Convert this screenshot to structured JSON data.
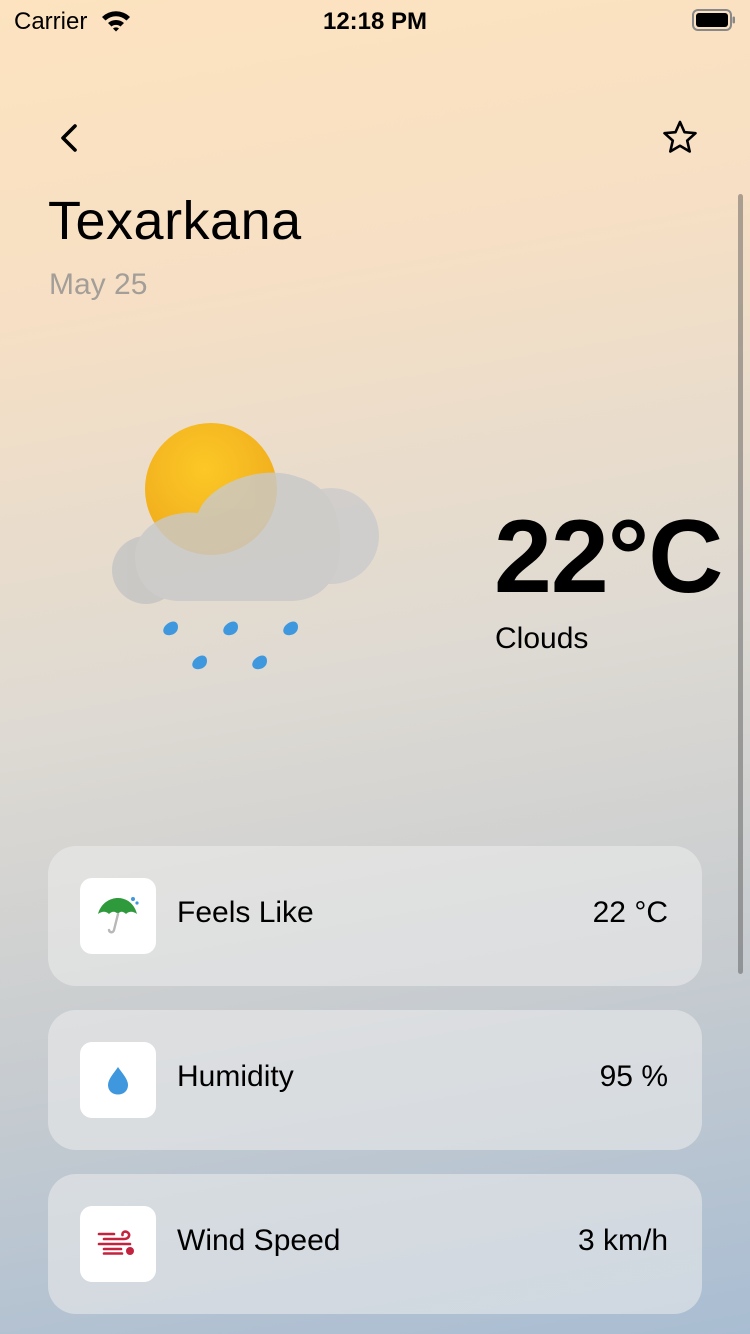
{
  "status_bar": {
    "carrier": "Carrier",
    "time": "12:18 PM"
  },
  "header": {
    "back_icon": "chevron-left-icon",
    "favorite_icon": "star-outline-icon"
  },
  "location": {
    "city": "Texarkana",
    "date": "May 25"
  },
  "current": {
    "temperature": "22°C",
    "condition": "Clouds",
    "icon": "sun-cloud-rain-icon",
    "colors": {
      "sun": "#f5b922",
      "cloud": "#cbcbcb",
      "rain": "#3f98de"
    }
  },
  "details": [
    {
      "icon": "umbrella-icon",
      "label": "Feels Like",
      "value": "22 °C",
      "icon_color": "#2e9a3b"
    },
    {
      "icon": "water-drop-icon",
      "label": "Humidity",
      "value": "95 %",
      "icon_color": "#3f98de"
    },
    {
      "icon": "wind-icon",
      "label": "Wind Speed",
      "value": "3 km/h",
      "icon_color": "#c4233f"
    }
  ]
}
